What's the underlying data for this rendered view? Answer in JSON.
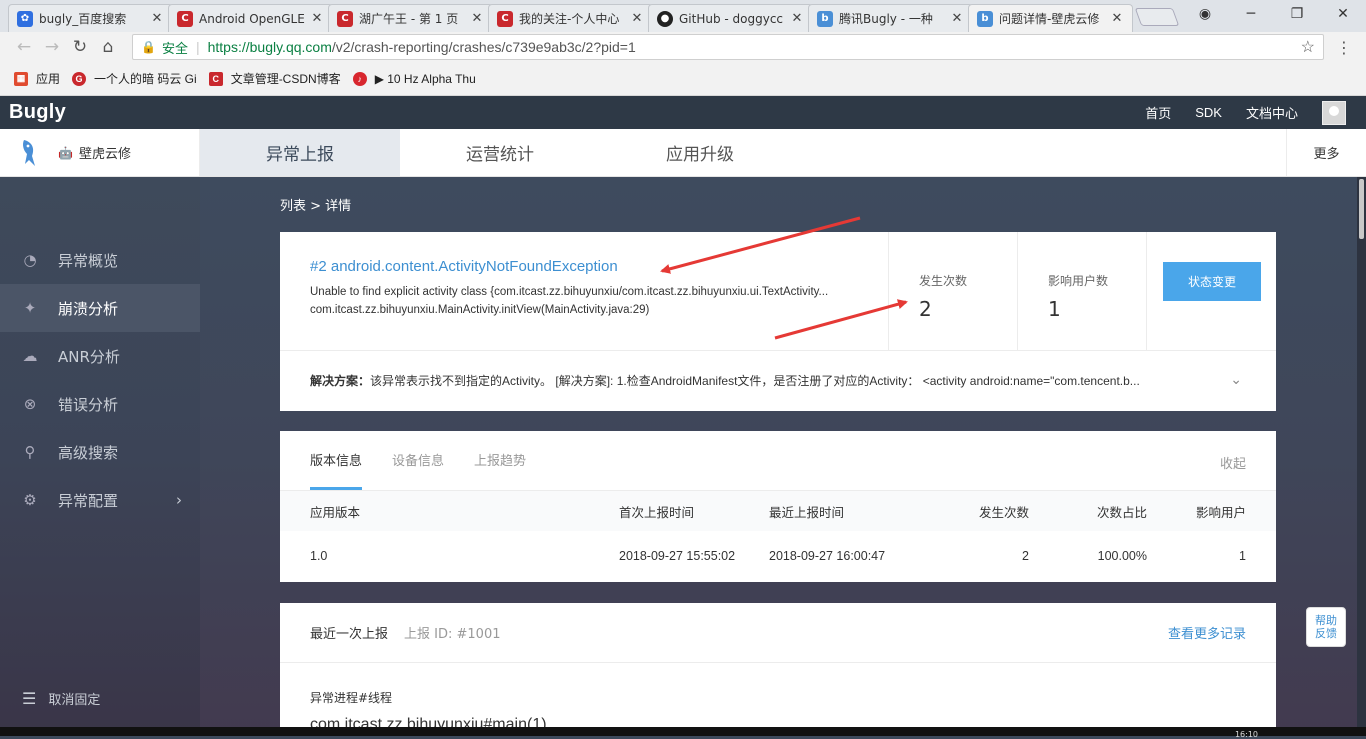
{
  "browser": {
    "tabs": [
      {
        "title": "bugly_百度搜索",
        "icon": "baidu-icon",
        "color": "#2f6fe0",
        "active": false
      },
      {
        "title": "Android OpenGLE",
        "icon": "csdn-icon",
        "color": "#c9282d",
        "active": false
      },
      {
        "title": "湖广午王 - 第 1 页",
        "icon": "csdn-icon",
        "color": "#c9282d",
        "active": false
      },
      {
        "title": "我的关注-个人中心",
        "icon": "csdn-icon",
        "color": "#c9282d",
        "active": false
      },
      {
        "title": "GitHub - doggycc",
        "icon": "github-icon",
        "color": "#222222",
        "active": false
      },
      {
        "title": "腾讯Bugly - 一种",
        "icon": "bugly-icon",
        "color": "#4a8fd6",
        "active": false
      },
      {
        "title": "问题详情-壁虎云修",
        "icon": "bugly-icon",
        "color": "#4a8fd6",
        "active": true
      }
    ],
    "close_glyph": "✕",
    "secure_label": "安全",
    "url_host": "https://bugly.qq.com",
    "url_path": "/v2/crash-reporting/crashes/c739e9ab3c/2?pid=1",
    "bookmarks": [
      {
        "label": "应用",
        "icon": "apps-grid-icon",
        "color": "#e04b2f"
      },
      {
        "label": "一个人的暗  码云 Gi",
        "icon": "gitee-icon",
        "color": "#c9282d"
      },
      {
        "label": "文章管理-CSDN博客",
        "icon": "csdn-icon",
        "color": "#c9282d"
      },
      {
        "label": "▶ 10 Hz Alpha Thu",
        "icon": "netease-music-icon",
        "color": "#d8262e"
      }
    ]
  },
  "app": {
    "brand": "Bugly",
    "top_links": [
      "首页",
      "SDK",
      "文档中心"
    ],
    "app_name": "壁虎云修",
    "main_tabs": [
      {
        "label": "异常上报",
        "active": true
      },
      {
        "label": "运营统计",
        "active": false
      },
      {
        "label": "应用升级",
        "active": false
      }
    ],
    "more": "更多",
    "sidebar": [
      {
        "label": "异常概览",
        "icon": "dashboard-icon",
        "active": false
      },
      {
        "label": "崩溃分析",
        "icon": "crash-icon",
        "active": true
      },
      {
        "label": "ANR分析",
        "icon": "anr-icon",
        "active": false
      },
      {
        "label": "错误分析",
        "icon": "error-icon",
        "active": false
      },
      {
        "label": "高级搜索",
        "icon": "search-icon",
        "active": false
      },
      {
        "label": "异常配置",
        "icon": "gear-icon",
        "active": false
      }
    ],
    "unpin": "取消固定"
  },
  "detail": {
    "breadcrumb": "列表 > 详情",
    "title": "#2 android.content.ActivityNotFoundException",
    "line1": "Unable to find explicit activity class {com.itcast.zz.bihuyunxiu/com.itcast.zz.bihuyunxiu.ui.TextActivity...",
    "line2": "com.itcast.zz.bihuyunxiu.MainActivity.initView(MainActivity.java:29)",
    "occurrences_label": "发生次数",
    "occurrences": "2",
    "users_label": "影响用户数",
    "users": "1",
    "status_button": "状态变更",
    "solution_label": "解决方案：",
    "solution_text": "该异常表示找不到指定的Activity。 [解决方案]:   1.检查AndroidManifest文件，是否注册了对应的Activity：  <activity android:name=\"com.tencent.b..."
  },
  "version": {
    "tabs": [
      {
        "label": "版本信息",
        "active": true
      },
      {
        "label": "设备信息",
        "active": false
      },
      {
        "label": "上报趋势",
        "active": false
      }
    ],
    "collapse": "收起",
    "columns": [
      "应用版本",
      "首次上报时间",
      "最近上报时间",
      "发生次数",
      "次数占比",
      "影响用户"
    ],
    "rows": [
      [
        "1.0",
        "2018-09-27 15:55:02",
        "2018-09-27 16:00:47",
        "2",
        "100.00%",
        "1"
      ]
    ]
  },
  "latest": {
    "title": "最近一次上报",
    "report_id": "上报 ID:  #1001",
    "more_link": "查看更多记录",
    "process_label": "异常进程#线程",
    "thread": "com.itcast.zz.bihuyunxiu#main(1)"
  },
  "help": {
    "line1": "帮助",
    "line2": "反馈"
  },
  "clock": "16:10",
  "colors": {
    "accent": "#4aa6ea",
    "link": "#3d8fd1",
    "topbar": "#2e3946",
    "annotation_arrow": "#e53935"
  }
}
